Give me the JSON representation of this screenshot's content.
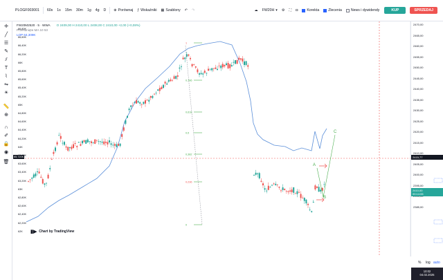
{
  "toolbar": {
    "symbol": "PLOGF003001",
    "intervals": [
      "60s",
      "1s",
      "15m",
      "30m",
      "1g",
      "4g",
      "D"
    ],
    "compare_label": "Porównaj",
    "indicators_label": "Wskaźniki",
    "templates_label": "Szablony",
    "instrument": "FW20H",
    "checkboxes": [
      {
        "label": "Korekta",
        "checked": true
      },
      {
        "label": "Zlecenia",
        "checked": true
      },
      {
        "label": "News i dywidendy",
        "checked": false
      }
    ],
    "buy_label": "KUP",
    "sell_label": "SPRZEDAJ"
  },
  "legend": {
    "title": "FW20M2520 · 5 · WWA",
    "ohlc": "O 2409,00 H 2410,00 L 2408,00 C 2410,00 +2,00 (+0,08%)",
    "ma_label": "Przesunięte MA  10  53",
    "lop_label": "LOP 64,309K"
  },
  "price_scale": {
    "right_labels": [
      "2470,00",
      "2465,00",
      "2460,00",
      "2455,00",
      "2450,00",
      "2445,00",
      "2440,00",
      "2435,00",
      "2430,00",
      "2425,00",
      "2420,00",
      "2415,00",
      "2410,00",
      "2405,00",
      "2400,00",
      "2395,00",
      "2390,00",
      "2385,00"
    ],
    "current_price": "2410,00",
    "current_price_sub": "00:14:06",
    "crosshair_price": "2415,77",
    "left_labels": [
      "66,80K",
      "66,60K",
      "66,40K",
      "66,20K",
      "66K",
      "65,80K",
      "65,60K",
      "65,40K",
      "65,20K",
      "65K",
      "64,80K",
      "64,60K",
      "64,40K",
      "64,20K",
      "64K",
      "63,80K",
      "63,60K",
      "63,40K",
      "63,20K",
      "63K",
      "62,80K",
      "62,60K",
      "62,40K",
      "62,20K",
      "62K"
    ],
    "crosshair_left": "65,720K"
  },
  "fib_levels": [
    "1",
    "0,786",
    "0,618",
    "0,5",
    "0,382",
    "0,236",
    "0"
  ],
  "wave_labels": [
    "A",
    "B",
    "C"
  ],
  "watermark": "Chart by TradingView",
  "bottom": {
    "percent": "%",
    "log": "log",
    "auto": "auto",
    "time": "10:02",
    "date": "04.02.2025"
  },
  "colors": {
    "up": "#26a69a",
    "down": "#ef5350",
    "ma": "#5b8fd9",
    "fib": "#4caf50",
    "accent": "#2962ff"
  }
}
